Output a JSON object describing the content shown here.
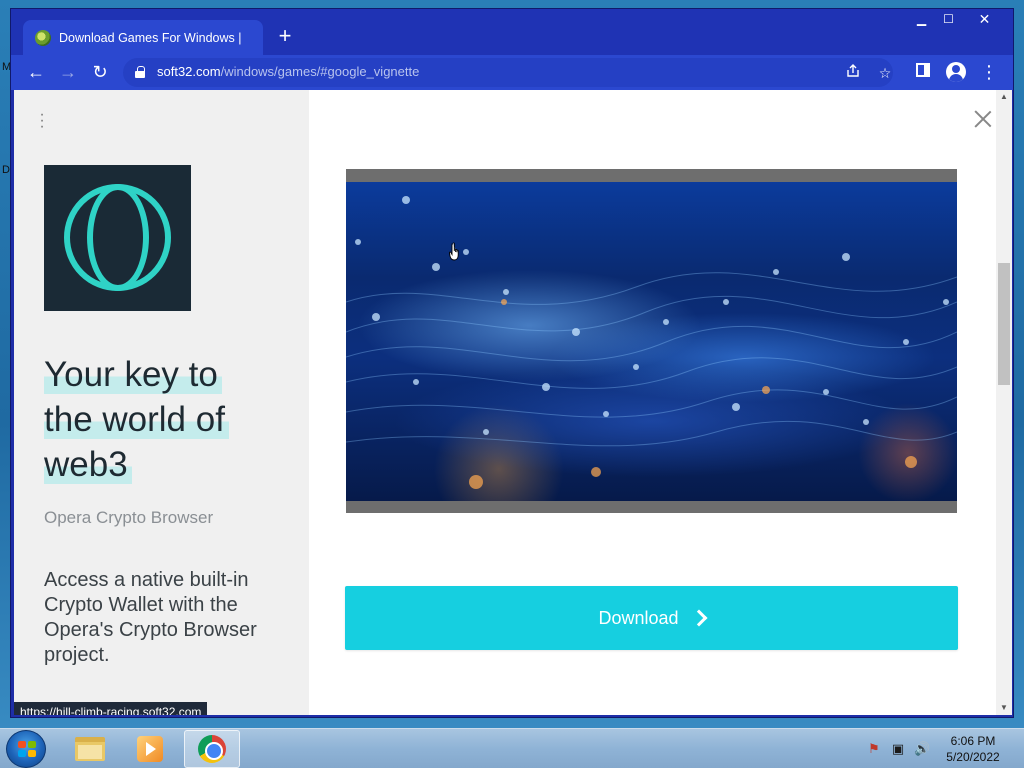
{
  "desktop": {
    "glyph_top": "M",
    "glyph_mid": "D"
  },
  "browser": {
    "tab_title": "Download Games For Windows |",
    "new_tab": "+",
    "window_controls": {
      "minimize": "▁",
      "maximize": "☐",
      "close": "✕"
    },
    "nav": {
      "back": "←",
      "forward": "→",
      "reload": "↻"
    },
    "url": {
      "domain": "soft32.com",
      "path": "/windows/games/#google_vignette"
    },
    "omnibox_icons": [
      "share-icon",
      "bookmark-star-icon"
    ],
    "toolbar_icons": {
      "side_panel": "▮",
      "menu": "⋮"
    },
    "status_url": "https://hill-climb-racing.soft32.com"
  },
  "ad": {
    "menu_icon": "⋮",
    "headline": [
      "Your key to",
      "the world of",
      "web3"
    ],
    "subtitle": "Opera Crypto Browser",
    "body": "Access a native built-in Crypto Wallet with the Opera's Crypto Browser project.",
    "download_label": "Download",
    "accent_color": "#16cfe0",
    "logo_color": "#2fd3c6"
  },
  "taskbar": {
    "apps": [
      "windows-explorer",
      "media-player",
      "google-chrome"
    ],
    "tray": {
      "flag": "⚑",
      "network": "▣",
      "volume": "🔊"
    },
    "clock": {
      "time": "6:06 PM",
      "date": "5/20/2022"
    }
  }
}
